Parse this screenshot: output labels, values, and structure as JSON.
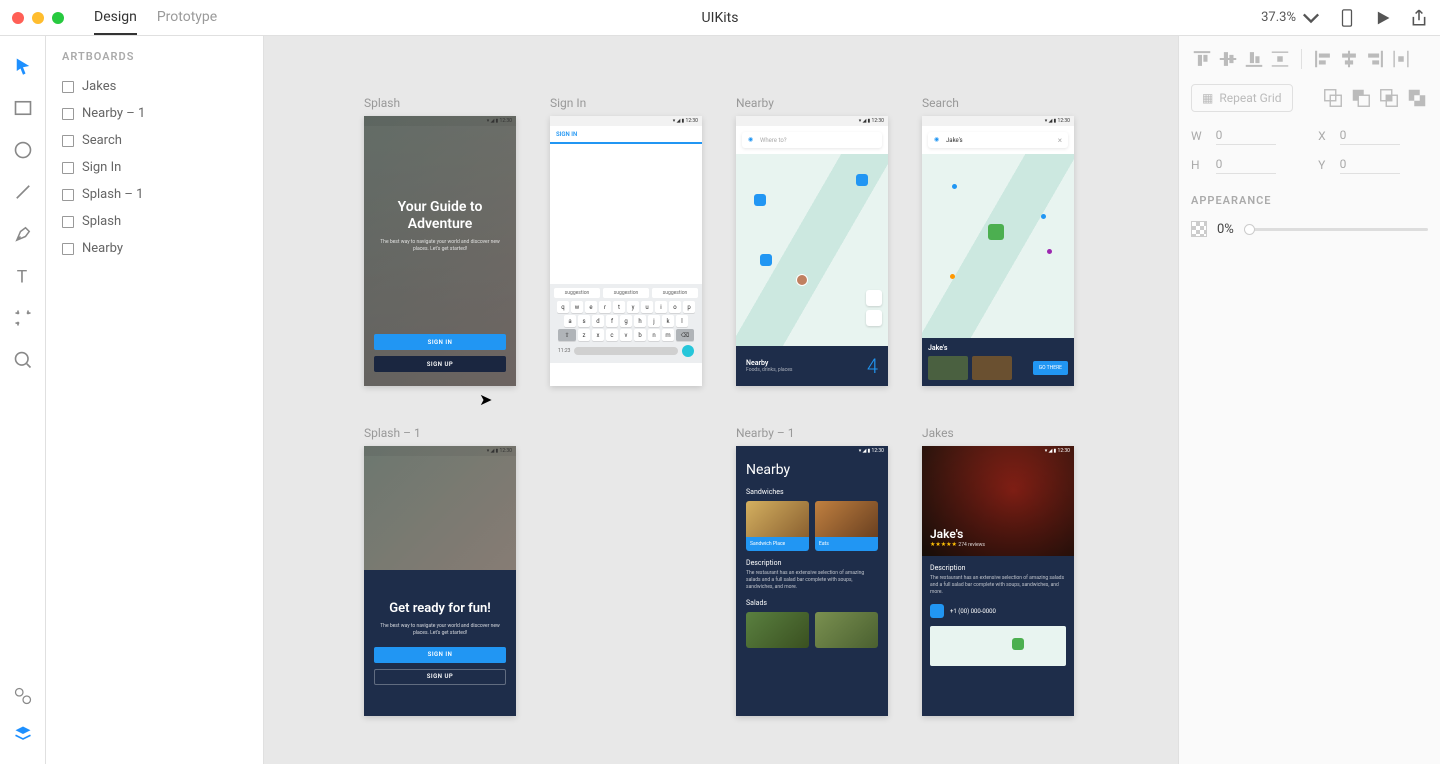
{
  "topbar": {
    "tabs": {
      "design": "Design",
      "prototype": "Prototype"
    },
    "title": "UIKits",
    "zoom": "37.3%"
  },
  "layers": {
    "heading": "ARTBOARDS",
    "items": [
      "Jakes",
      "Nearby – 1",
      "Search",
      "Sign In",
      "Splash – 1",
      "Splash",
      "Nearby"
    ]
  },
  "artboards": {
    "splash": {
      "label": "Splash",
      "title": "Your Guide to Adventure",
      "sub": "The best way to navigate your world and discover new places. Let's get started!",
      "signin": "SIGN IN",
      "signup": "SIGN UP"
    },
    "signin": {
      "label": "Sign In",
      "field": "SIGN IN",
      "suggestion": "suggestion",
      "time": "11:23"
    },
    "nearby": {
      "label": "Nearby",
      "placeholder": "Where to?",
      "bar_title": "Nearby",
      "bar_sub": "Foods, drinks, places",
      "count": "4"
    },
    "search": {
      "label": "Search",
      "query": "Jake's",
      "card_title": "Jake's",
      "go": "GO THERE"
    },
    "splash1": {
      "label": "Splash – 1",
      "title": "Get ready for fun!",
      "sub": "The best way to navigate your world and discover new places. Let's get started!",
      "signin": "SIGN IN",
      "signup": "SIGN UP"
    },
    "nearby1": {
      "label": "Nearby – 1",
      "title": "Nearby",
      "section1": "Sandwiches",
      "card1": "Sandwich Place",
      "card2": "Eats",
      "desc_t": "Description",
      "desc": "The restaurant has an extensive selection of amazing salads and a full salad bar complete with soups, sandwiches, and more.",
      "section2": "Salads"
    },
    "jakes": {
      "label": "Jakes",
      "title": "Jake's",
      "stars": "★★★★★",
      "reviews": "274 reviews",
      "desc_t": "Description",
      "desc": "The restaurant has an extensive selection of amazing salads and a full salad bar complete with soups, sandwiches, and more.",
      "phone": "+1 (00) 000-0000"
    }
  },
  "inspector": {
    "repeat": "Repeat Grid",
    "w": "W",
    "w_val": "0",
    "x": "X",
    "x_val": "0",
    "h": "H",
    "h_val": "0",
    "y": "Y",
    "y_val": "0",
    "appearance": "APPEARANCE",
    "opacity": "0%"
  },
  "keyboard": {
    "r1": [
      "q",
      "w",
      "e",
      "r",
      "t",
      "y",
      "u",
      "i",
      "o",
      "p"
    ],
    "r2": [
      "a",
      "s",
      "d",
      "f",
      "g",
      "h",
      "j",
      "k",
      "l"
    ],
    "r3": [
      "z",
      "x",
      "c",
      "v",
      "b",
      "n",
      "m"
    ]
  }
}
